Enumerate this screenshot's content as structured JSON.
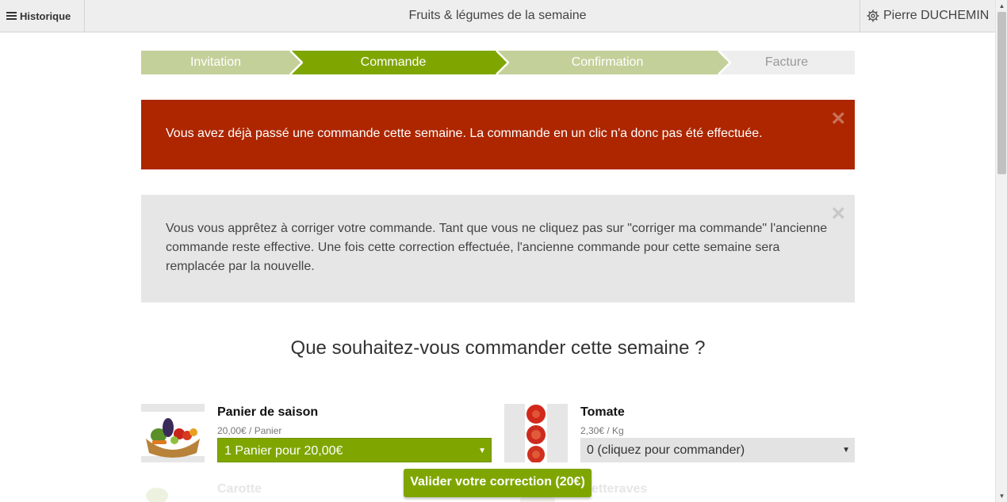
{
  "topbar": {
    "history_label": "Historique",
    "title": "Fruits & légumes de la semaine",
    "user_name": "Pierre DUCHEMIN"
  },
  "steps": [
    {
      "label": "Invitation",
      "state": "done"
    },
    {
      "label": "Commande",
      "state": "active"
    },
    {
      "label": "Confirmation",
      "state": "done"
    },
    {
      "label": "Facture",
      "state": "todo"
    }
  ],
  "alerts": {
    "danger_text": "Vous avez déjà passé une commande cette semaine. La commande en un clic n'a donc pas été effectuée.",
    "info_text": "Vous vous apprêtez à corriger votre commande. Tant que vous ne cliquez pas sur \"corriger ma commande\" l'ancienne commande reste effective. Une fois cette correction effectuée, l'ancienne commande pour cette semaine sera remplacée par la nouvelle.",
    "close_glyph": "×"
  },
  "question": "Que souhaitez-vous commander cette semaine ?",
  "products": [
    {
      "name": "Panier de saison",
      "price": "20,00€ / Panier",
      "selected": "1 Panier pour 20,00€"
    },
    {
      "name": "Tomate",
      "price": "2,30€ / Kg",
      "selected": "0 (cliquez pour commander)"
    }
  ],
  "faded_products": [
    "Carotte",
    "etteraves"
  ],
  "validate_label": "Valider votre correction (20€)",
  "colors": {
    "accent": "#7fa600",
    "step_done": "#c3d09a",
    "danger": "#ad2600",
    "info_bg": "#e6e6e6"
  },
  "icons": {
    "menu": "hamburger-icon",
    "settings": "gear-icon",
    "select": "caret-down-icon"
  }
}
